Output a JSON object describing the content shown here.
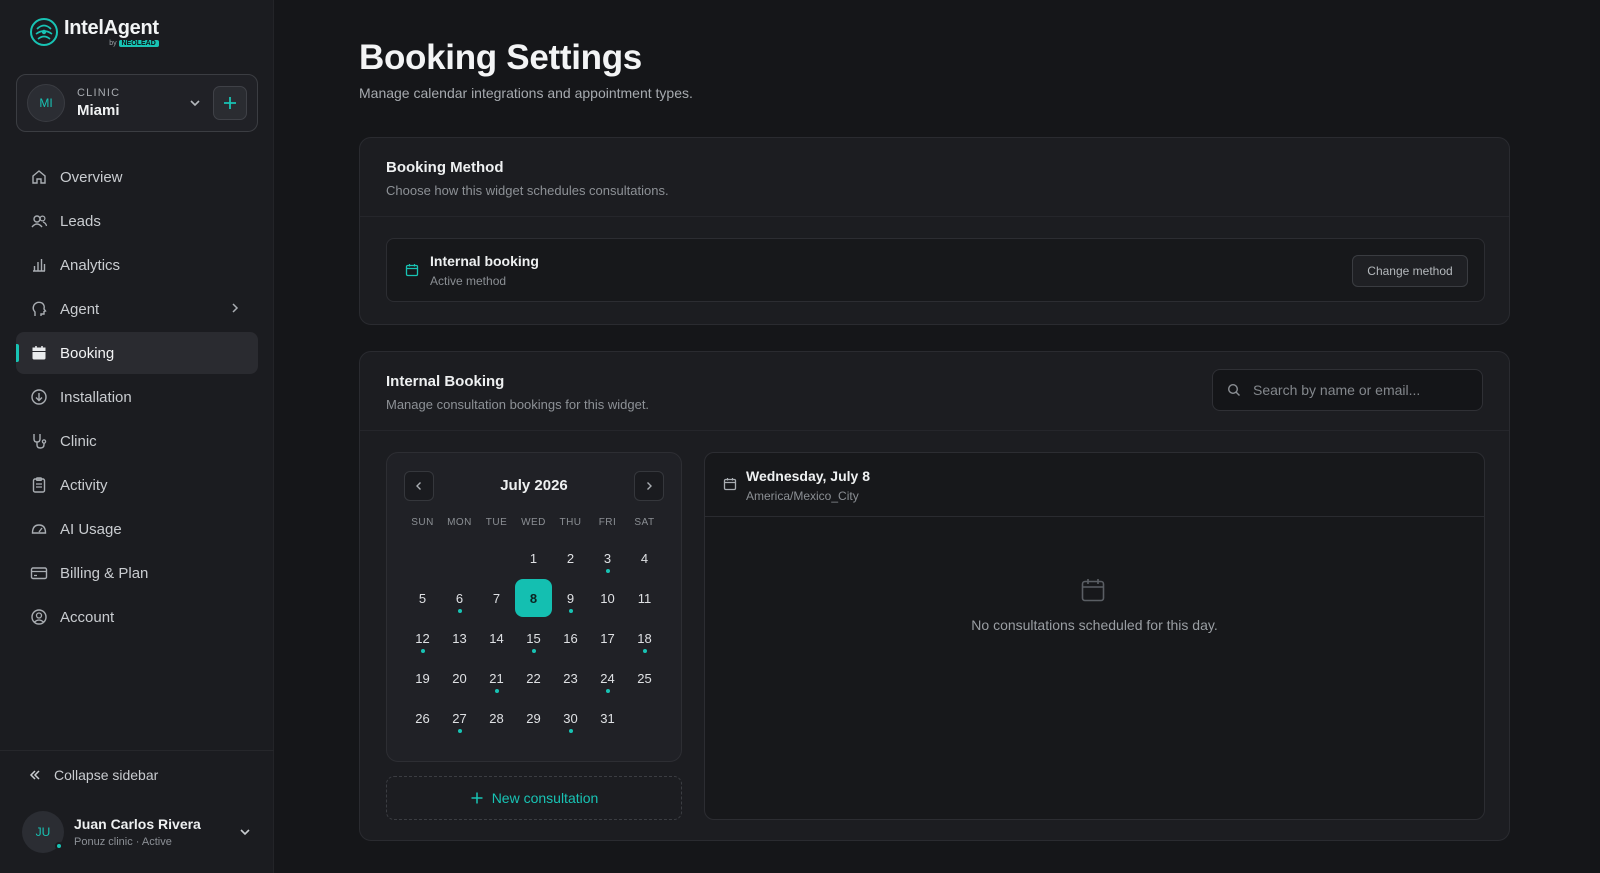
{
  "brand": {
    "name": "IntelAgent",
    "by": "by",
    "company": "NEOLEAD"
  },
  "clinic_switcher": {
    "initials": "MI",
    "label": "CLINIC",
    "name": "Miami"
  },
  "nav": {
    "items": [
      {
        "label": "Overview",
        "icon": "home-icon"
      },
      {
        "label": "Leads",
        "icon": "users-icon"
      },
      {
        "label": "Analytics",
        "icon": "bar-chart-icon"
      },
      {
        "label": "Agent",
        "icon": "agent-head-icon"
      },
      {
        "label": "Booking",
        "icon": "calendar-icon"
      },
      {
        "label": "Installation",
        "icon": "download-circle-icon"
      },
      {
        "label": "Clinic",
        "icon": "stethoscope-icon"
      },
      {
        "label": "Activity",
        "icon": "clipboard-icon"
      },
      {
        "label": "AI Usage",
        "icon": "gauge-icon"
      },
      {
        "label": "Billing & Plan",
        "icon": "credit-card-icon"
      },
      {
        "label": "Account",
        "icon": "user-circle-icon"
      }
    ],
    "active": "Booking"
  },
  "sidebar_footer": {
    "collapse_label": "Collapse sidebar",
    "user": {
      "initials": "JU",
      "name": "Juan Carlos Rivera",
      "meta": "Ponuz clinic · Active"
    }
  },
  "page": {
    "title": "Booking Settings",
    "subtitle": "Manage calendar integrations and appointment types."
  },
  "booking_method": {
    "title": "Booking Method",
    "subtitle": "Choose how this widget schedules consultations.",
    "method_name": "Internal booking",
    "method_status": "Active method",
    "change_label": "Change method"
  },
  "internal_booking": {
    "title": "Internal Booking",
    "subtitle": "Manage consultation bookings for this widget.",
    "search_placeholder": "Search by name or email..."
  },
  "calendar": {
    "month_label": "July 2026",
    "weekdays": [
      "SUN",
      "MON",
      "TUE",
      "WED",
      "THU",
      "FRI",
      "SAT"
    ],
    "leading_blanks": 3,
    "days_in_month": 31,
    "selected_day": 8,
    "days_with_bookings": [
      3,
      6,
      9,
      12,
      15,
      18,
      21,
      24,
      27,
      30
    ]
  },
  "new_consultation_label": "New consultation",
  "day_panel": {
    "date_title": "Wednesday, July 8",
    "timezone": "America/Mexico_City",
    "empty_message": "No consultations scheduled for this day."
  },
  "colors": {
    "accent": "#18c3b4",
    "background": "#151619",
    "sidebar": "#1b1c20",
    "card": "#1c1d21"
  }
}
